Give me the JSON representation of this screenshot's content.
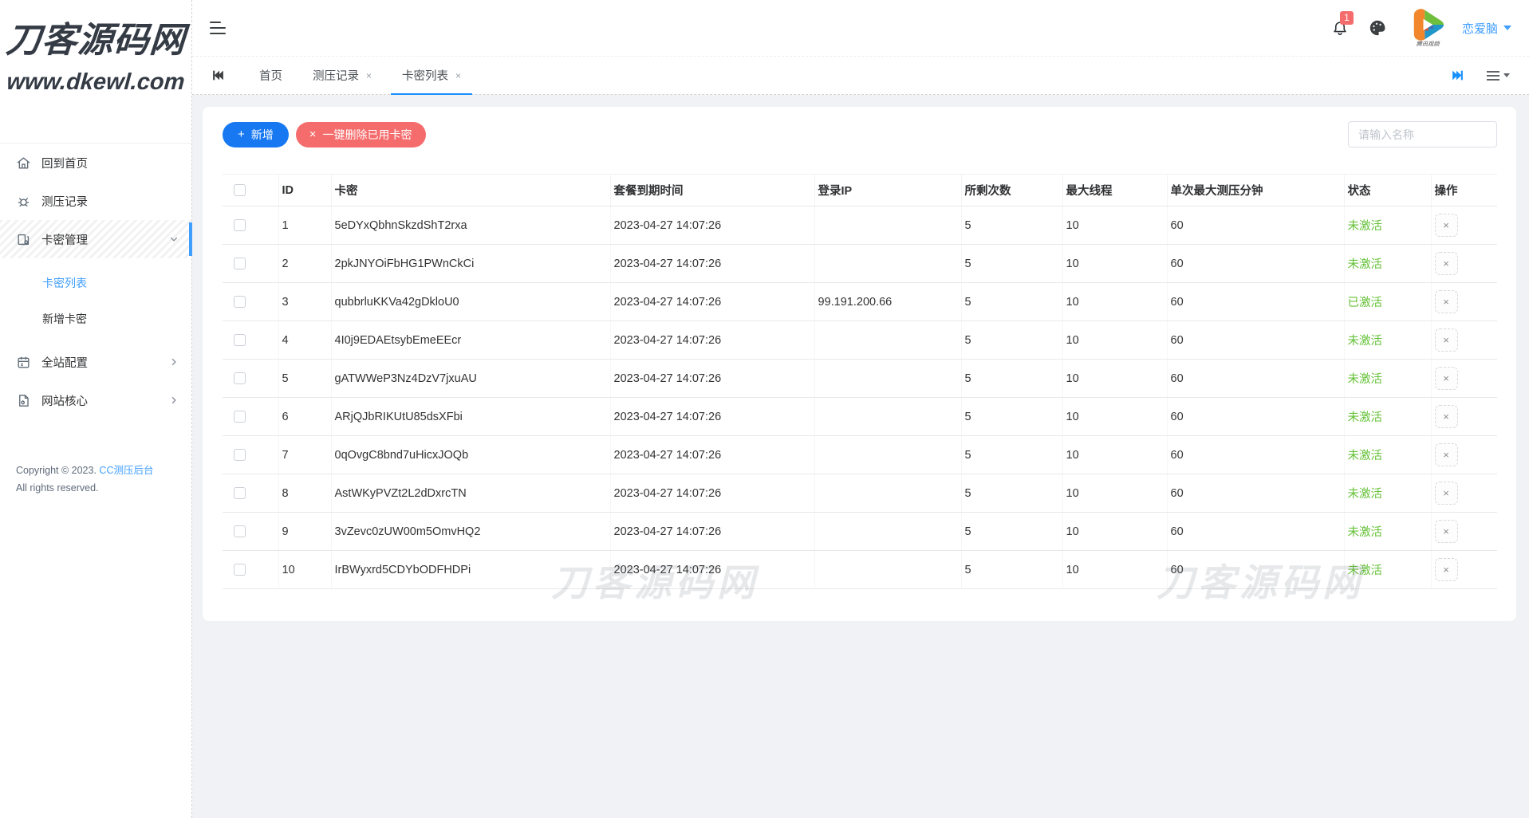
{
  "brand": {
    "title": "刀客源码网",
    "subtitle": "www.dkewl.com"
  },
  "sidebar": {
    "items": [
      {
        "label": "回到首页"
      },
      {
        "label": "测压记录"
      },
      {
        "label": "卡密管理"
      },
      {
        "label": "卡密列表"
      },
      {
        "label": "新增卡密"
      },
      {
        "label": "全站配置"
      },
      {
        "label": "网站核心"
      }
    ],
    "copyright": {
      "prefix": "Copyright © 2023. ",
      "link": "CC测压后台",
      "line2": "All rights reserved."
    }
  },
  "topbar": {
    "notification_count": "1",
    "username": "恋爱脑",
    "avatar_caption": "腾讯视频"
  },
  "tabs": {
    "items": [
      {
        "label": "首页",
        "closable": false,
        "active": false
      },
      {
        "label": "测压记录",
        "closable": true,
        "active": false
      },
      {
        "label": "卡密列表",
        "closable": true,
        "active": true
      }
    ]
  },
  "toolbar": {
    "add_label": "新增",
    "delete_label": "一键删除已用卡密",
    "search_placeholder": "请输入名称"
  },
  "table": {
    "headers": [
      "ID",
      "卡密",
      "套餐到期时间",
      "登录IP",
      "所剩次数",
      "最大线程",
      "单次最大测压分钟",
      "状态",
      "操作"
    ],
    "rows": [
      {
        "id": "1",
        "key": "5eDYxQbhnSkzdShT2rxa",
        "expire": "2023-04-27 14:07:26",
        "ip": "",
        "times": "5",
        "threads": "10",
        "minutes": "60",
        "status": "未激活"
      },
      {
        "id": "2",
        "key": "2pkJNYOiFbHG1PWnCkCi",
        "expire": "2023-04-27 14:07:26",
        "ip": "",
        "times": "5",
        "threads": "10",
        "minutes": "60",
        "status": "未激活"
      },
      {
        "id": "3",
        "key": "qubbrluKKVa42gDkloU0",
        "expire": "2023-04-27 14:07:26",
        "ip": "99.191.200.66",
        "times": "5",
        "threads": "10",
        "minutes": "60",
        "status": "已激活"
      },
      {
        "id": "4",
        "key": "4I0j9EDAEtsybEmeEEcr",
        "expire": "2023-04-27 14:07:26",
        "ip": "",
        "times": "5",
        "threads": "10",
        "minutes": "60",
        "status": "未激活"
      },
      {
        "id": "5",
        "key": "gATWWeP3Nz4DzV7jxuAU",
        "expire": "2023-04-27 14:07:26",
        "ip": "",
        "times": "5",
        "threads": "10",
        "minutes": "60",
        "status": "未激活"
      },
      {
        "id": "6",
        "key": "ARjQJbRIKUtU85dsXFbi",
        "expire": "2023-04-27 14:07:26",
        "ip": "",
        "times": "5",
        "threads": "10",
        "minutes": "60",
        "status": "未激活"
      },
      {
        "id": "7",
        "key": "0qOvgC8bnd7uHicxJOQb",
        "expire": "2023-04-27 14:07:26",
        "ip": "",
        "times": "5",
        "threads": "10",
        "minutes": "60",
        "status": "未激活"
      },
      {
        "id": "8",
        "key": "AstWKyPVZt2L2dDxrcTN",
        "expire": "2023-04-27 14:07:26",
        "ip": "",
        "times": "5",
        "threads": "10",
        "minutes": "60",
        "status": "未激活"
      },
      {
        "id": "9",
        "key": "3vZevc0zUW00m5OmvHQ2",
        "expire": "2023-04-27 14:07:26",
        "ip": "",
        "times": "5",
        "threads": "10",
        "minutes": "60",
        "status": "未激活"
      },
      {
        "id": "10",
        "key": "IrBWyxrd5CDYbODFHDPi",
        "expire": "2023-04-27 14:07:26",
        "ip": "",
        "times": "5",
        "threads": "10",
        "minutes": "60",
        "status": "未激活"
      }
    ]
  },
  "watermark": "刀客源码网",
  "icons": {
    "plus": "+",
    "close": "×"
  },
  "colors": {
    "primary": "#1778f2",
    "danger": "#f56c6c",
    "success": "#67c23a",
    "link": "#409eff",
    "tab_underline": "#1890ff"
  }
}
